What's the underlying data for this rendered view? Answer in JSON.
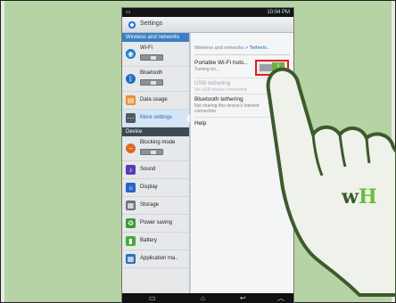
{
  "status_bar": {
    "time": "10:04 PM",
    "signal_icon": "signal-icon",
    "battery_icon": "battery-icon"
  },
  "app": {
    "title": "Settings",
    "icon": "settings-gear-icon"
  },
  "left_pane": {
    "wireless_header": "Wireless and networks",
    "device_header": "Device",
    "items": [
      {
        "label": "Wi-Fi",
        "icon": "wifi-icon",
        "color": "#1f78c8",
        "has_toggle": true
      },
      {
        "label": "Bluetooth",
        "icon": "bluetooth-icon",
        "color": "#1f6fbf",
        "has_toggle": true
      },
      {
        "label": "Data usage",
        "icon": "data-usage-icon",
        "color": "#e6922a",
        "has_toggle": false
      },
      {
        "label": "More settings",
        "icon": "more-settings-icon",
        "color": "#4f5a62",
        "has_toggle": false,
        "selected": true
      },
      {
        "label": "Blocking mode",
        "icon": "blocking-mode-icon",
        "color": "#e16b1f",
        "has_toggle": true
      },
      {
        "label": "Sound",
        "icon": "sound-icon",
        "color": "#5a3bb8",
        "has_toggle": false
      },
      {
        "label": "Display",
        "icon": "display-icon",
        "color": "#2a62c9",
        "has_toggle": false
      },
      {
        "label": "Storage",
        "icon": "storage-icon",
        "color": "#6d7278",
        "has_toggle": false
      },
      {
        "label": "Power saving",
        "icon": "power-saving-icon",
        "color": "#3a9a3a",
        "has_toggle": false
      },
      {
        "label": "Battery",
        "icon": "battery-setting-icon",
        "color": "#4aa83a",
        "has_toggle": false
      },
      {
        "label": "Application ma..",
        "icon": "application-manager-icon",
        "color": "#2d6fbd",
        "has_toggle": false
      }
    ]
  },
  "right_pane": {
    "breadcrumb_parent": "Wireless and networks",
    "breadcrumb_sep": ">",
    "breadcrumb_current": "Tetherin..",
    "rows": [
      {
        "title": "Portable Wi-Fi hots..",
        "subtitle": "Turning on...",
        "disabled": false
      },
      {
        "title": "USB tethering",
        "subtitle": "No USB device connected",
        "disabled": true
      },
      {
        "title": "Bluetooth tethering",
        "subtitle": "Not sharing this device's Internet connection",
        "disabled": false
      },
      {
        "title": "Help",
        "subtitle": "",
        "disabled": false
      }
    ],
    "hotspot_toggle": {
      "state": "on",
      "thumb_glyph": "I"
    }
  },
  "nav_bar": {
    "recent_icon": "recent-apps-icon",
    "home_icon": "home-icon",
    "back_icon": "back-icon",
    "menu_icon": "menu-up-icon"
  },
  "overlay": {
    "logo_w": "w",
    "logo_h": "H",
    "colors": {
      "background": "#b6d3a6",
      "hand_outline": "#3d5a2c",
      "hand_fill": "#eef2ea",
      "logo_green": "#6bbd3b"
    }
  }
}
